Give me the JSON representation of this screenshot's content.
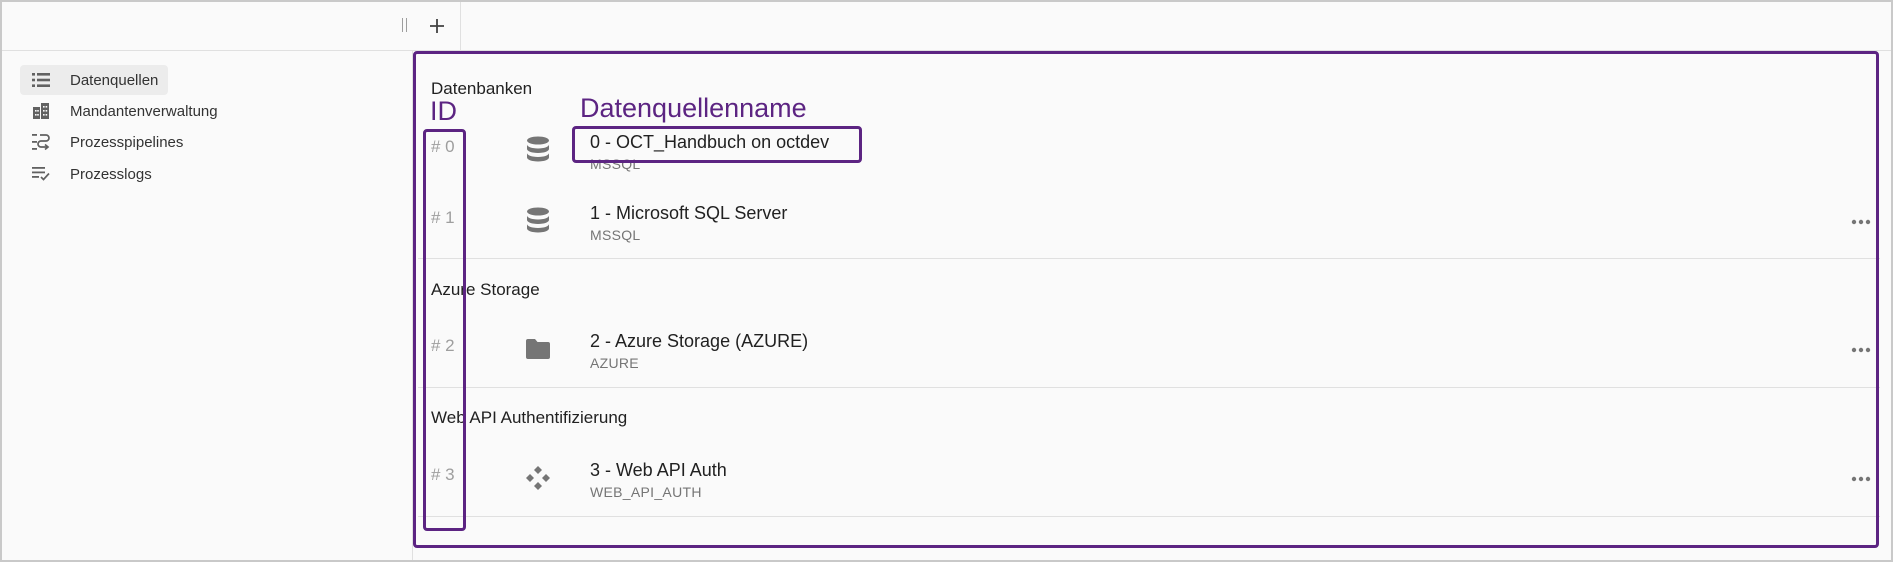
{
  "toolbar": {
    "add_label": "+"
  },
  "sidebar": {
    "items": [
      {
        "label": "Datenquellen",
        "icon": "list-icon",
        "active": true
      },
      {
        "label": "Mandantenverwaltung",
        "icon": "buildings-icon",
        "active": false
      },
      {
        "label": "Prozesspipelines",
        "icon": "pipeline-icon",
        "active": false
      },
      {
        "label": "Prozesslogs",
        "icon": "checklist-icon",
        "active": false
      }
    ]
  },
  "annotations": {
    "id_label": "ID",
    "name_label": "Datenquellenname",
    "color": "#5c2482"
  },
  "sections": [
    {
      "title": "Datenbanken",
      "rows": [
        {
          "id": "# 0",
          "icon": "database-icon",
          "name": "0 - OCT_Handbuch on octdev",
          "type": "MSSQL",
          "has_menu": false
        },
        {
          "id": "# 1",
          "icon": "database-icon",
          "name": "1 - Microsoft SQL Server",
          "type": "MSSQL",
          "has_menu": true
        }
      ]
    },
    {
      "title": "Azure Storage",
      "rows": [
        {
          "id": "# 2",
          "icon": "folder-icon",
          "name": "2 - Azure Storage (AZURE)",
          "type": "AZURE",
          "has_menu": true
        }
      ]
    },
    {
      "title": "Web API Authentifizierung",
      "rows": [
        {
          "id": "# 3",
          "icon": "web-api-icon",
          "name": "3 - Web API Auth",
          "type": "WEB_API_AUTH",
          "has_menu": true
        }
      ]
    }
  ]
}
